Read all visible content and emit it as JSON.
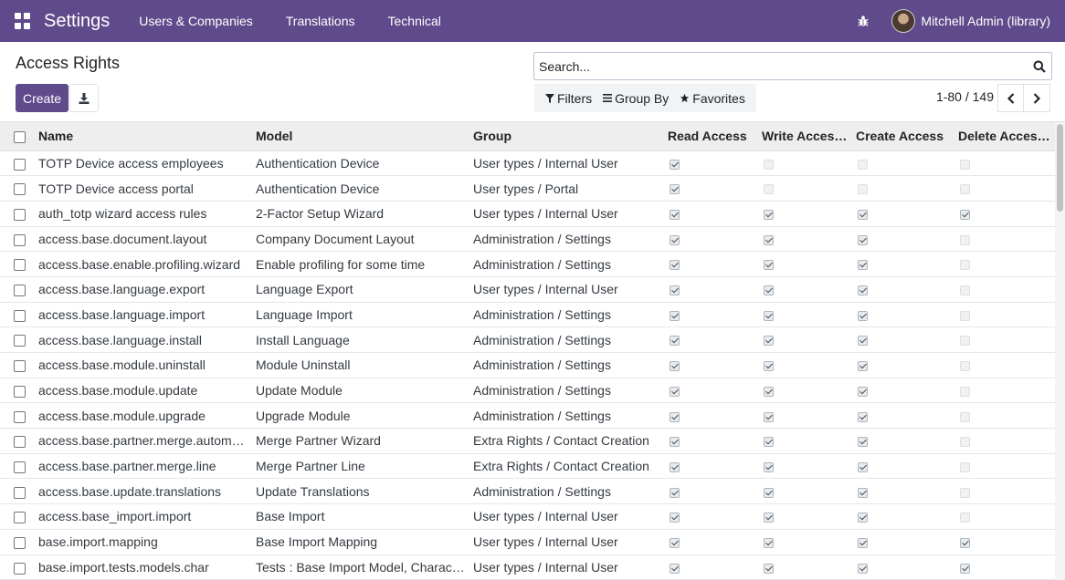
{
  "navbar": {
    "brand": "Settings",
    "menu": [
      "Users & Companies",
      "Translations",
      "Technical"
    ],
    "user": "Mitchell Admin (library)",
    "accent_color": "#5f4a8b"
  },
  "control": {
    "title": "Access Rights",
    "create_label": "Create",
    "search_placeholder": "Search...",
    "filters_label": "Filters",
    "groupby_label": "Group By",
    "favorites_label": "Favorites",
    "pager_text": "1-80 / 149"
  },
  "table": {
    "headers": [
      "Name",
      "Model",
      "Group",
      "Read Access",
      "Write Access...",
      "Create Access",
      "Delete Access..."
    ],
    "rows": [
      {
        "name": "TOTP Device access employees",
        "model": "Authentication Device",
        "group": "User types / Internal User",
        "read": true,
        "write": false,
        "create": false,
        "delete": false
      },
      {
        "name": "TOTP Device access portal",
        "model": "Authentication Device",
        "group": "User types / Portal",
        "read": true,
        "write": false,
        "create": false,
        "delete": false
      },
      {
        "name": "auth_totp wizard access rules",
        "model": "2-Factor Setup Wizard",
        "group": "User types / Internal User",
        "read": true,
        "write": true,
        "create": true,
        "delete": true
      },
      {
        "name": "access.base.document.layout",
        "model": "Company Document Layout",
        "group": "Administration / Settings",
        "read": true,
        "write": true,
        "create": true,
        "delete": false
      },
      {
        "name": "access.base.enable.profiling.wizard",
        "model": "Enable profiling for some time",
        "group": "Administration / Settings",
        "read": true,
        "write": true,
        "create": true,
        "delete": false
      },
      {
        "name": "access.base.language.export",
        "model": "Language Export",
        "group": "User types / Internal User",
        "read": true,
        "write": true,
        "create": true,
        "delete": false
      },
      {
        "name": "access.base.language.import",
        "model": "Language Import",
        "group": "Administration / Settings",
        "read": true,
        "write": true,
        "create": true,
        "delete": false
      },
      {
        "name": "access.base.language.install",
        "model": "Install Language",
        "group": "Administration / Settings",
        "read": true,
        "write": true,
        "create": true,
        "delete": false
      },
      {
        "name": "access.base.module.uninstall",
        "model": "Module Uninstall",
        "group": "Administration / Settings",
        "read": true,
        "write": true,
        "create": true,
        "delete": false
      },
      {
        "name": "access.base.module.update",
        "model": "Update Module",
        "group": "Administration / Settings",
        "read": true,
        "write": true,
        "create": true,
        "delete": false
      },
      {
        "name": "access.base.module.upgrade",
        "model": "Upgrade Module",
        "group": "Administration / Settings",
        "read": true,
        "write": true,
        "create": true,
        "delete": false
      },
      {
        "name": "access.base.partner.merge.automatic...",
        "model": "Merge Partner Wizard",
        "group": "Extra Rights / Contact Creation",
        "read": true,
        "write": true,
        "create": true,
        "delete": false
      },
      {
        "name": "access.base.partner.merge.line",
        "model": "Merge Partner Line",
        "group": "Extra Rights / Contact Creation",
        "read": true,
        "write": true,
        "create": true,
        "delete": false
      },
      {
        "name": "access.base.update.translations",
        "model": "Update Translations",
        "group": "Administration / Settings",
        "read": true,
        "write": true,
        "create": true,
        "delete": false
      },
      {
        "name": "access.base_import.import",
        "model": "Base Import",
        "group": "User types / Internal User",
        "read": true,
        "write": true,
        "create": true,
        "delete": false
      },
      {
        "name": "base.import.mapping",
        "model": "Base Import Mapping",
        "group": "User types / Internal User",
        "read": true,
        "write": true,
        "create": true,
        "delete": true
      },
      {
        "name": "base.import.tests.models.char",
        "model": "Tests : Base Import Model, Character",
        "group": "User types / Internal User",
        "read": true,
        "write": true,
        "create": true,
        "delete": true
      }
    ]
  }
}
